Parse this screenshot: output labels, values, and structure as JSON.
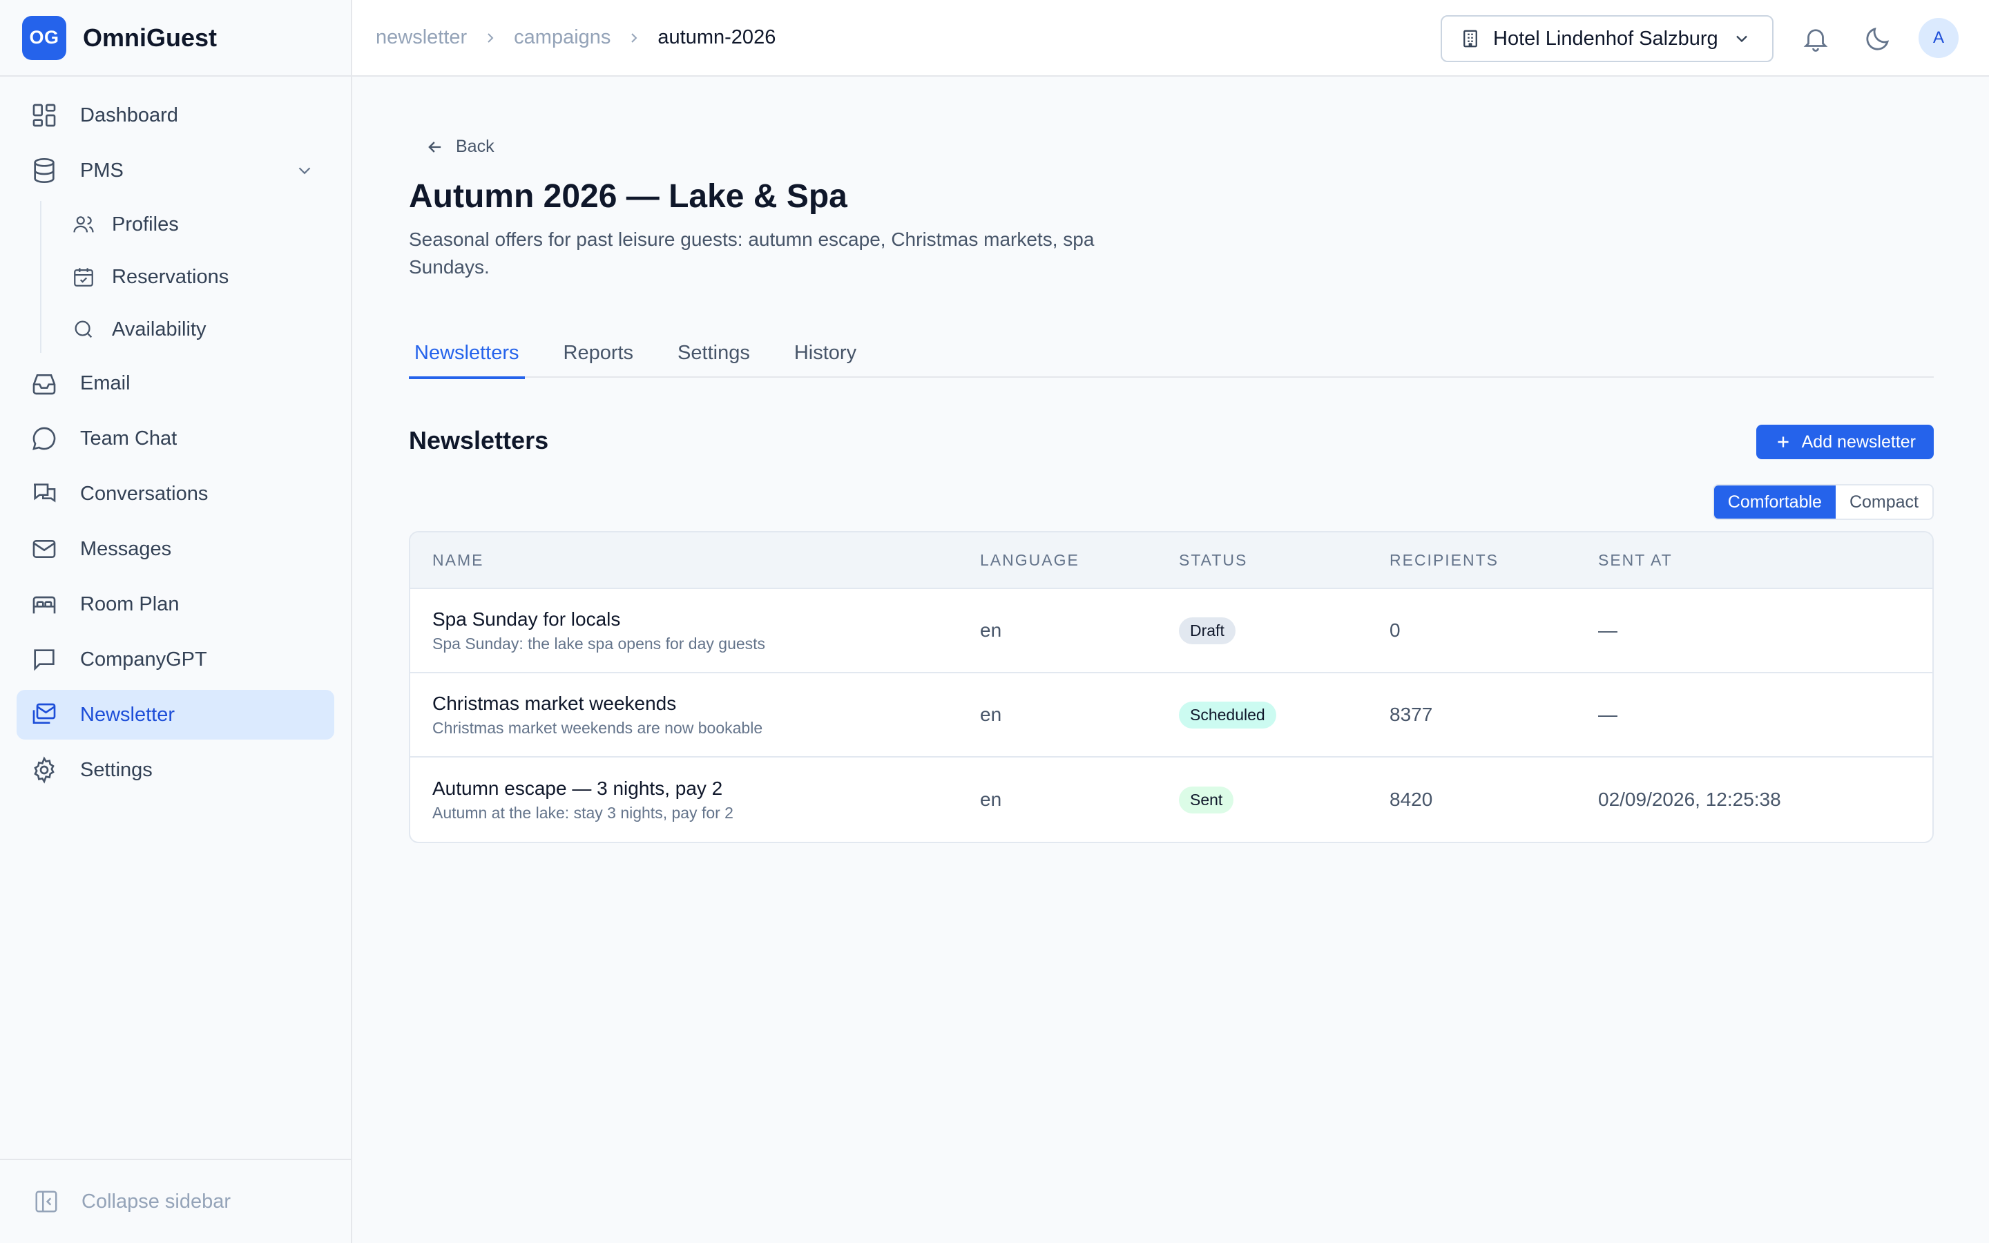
{
  "brand": {
    "logo_text": "OG",
    "name": "OmniGuest"
  },
  "sidebar": {
    "items": [
      {
        "label": "Dashboard",
        "icon": "dashboard-icon"
      },
      {
        "label": "PMS",
        "icon": "database-icon"
      },
      {
        "label": "Email",
        "icon": "inbox-icon"
      },
      {
        "label": "Team Chat",
        "icon": "chat-bubble-icon"
      },
      {
        "label": "Conversations",
        "icon": "conversations-icon"
      },
      {
        "label": "Messages",
        "icon": "mail-icon"
      },
      {
        "label": "Room Plan",
        "icon": "bed-icon"
      },
      {
        "label": "CompanyGPT",
        "icon": "message-square-icon"
      },
      {
        "label": "Newsletter",
        "icon": "newsletter-icon"
      },
      {
        "label": "Settings",
        "icon": "gear-icon"
      }
    ],
    "pms_sub": [
      {
        "label": "Profiles",
        "icon": "users-icon"
      },
      {
        "label": "Reservations",
        "icon": "calendar-check-icon"
      },
      {
        "label": "Availability",
        "icon": "search-icon"
      }
    ],
    "collapse_label": "Collapse sidebar"
  },
  "header": {
    "breadcrumb": [
      "newsletter",
      "campaigns",
      "autumn-2026"
    ],
    "hotel": "Hotel Lindenhof Salzburg",
    "avatar": "A"
  },
  "page": {
    "back_label": "Back",
    "title": "Autumn 2026 — Lake & Spa",
    "description": "Seasonal offers for past leisure guests: autumn escape, Christmas markets, spa Sundays.",
    "tabs": [
      "Newsletters",
      "Reports",
      "Settings",
      "History"
    ],
    "section_title": "Newsletters",
    "add_label": "Add newsletter",
    "density": [
      "Comfortable",
      "Compact"
    ]
  },
  "table": {
    "headers": [
      "NAME",
      "LANGUAGE",
      "STATUS",
      "RECIPIENTS",
      "SENT AT"
    ],
    "rows": [
      {
        "name": "Spa Sunday for locals",
        "subject": "Spa Sunday: the lake spa opens for day guests",
        "language": "en",
        "status": "Draft",
        "recipients": "0",
        "sent_at": "—"
      },
      {
        "name": "Christmas market weekends",
        "subject": "Christmas market weekends are now bookable",
        "language": "en",
        "status": "Scheduled",
        "recipients": "8377",
        "sent_at": "—"
      },
      {
        "name": "Autumn escape — 3 nights, pay 2",
        "subject": "Autumn at the lake: stay 3 nights, pay for 2",
        "language": "en",
        "status": "Sent",
        "recipients": "8420",
        "sent_at": "02/09/2026, 12:25:38"
      }
    ]
  },
  "colors": {
    "accent": "#2563eb",
    "draft_badge": "#e2e8f0",
    "scheduled_badge": "#ccfbf1",
    "sent_badge": "#dcfce7"
  }
}
